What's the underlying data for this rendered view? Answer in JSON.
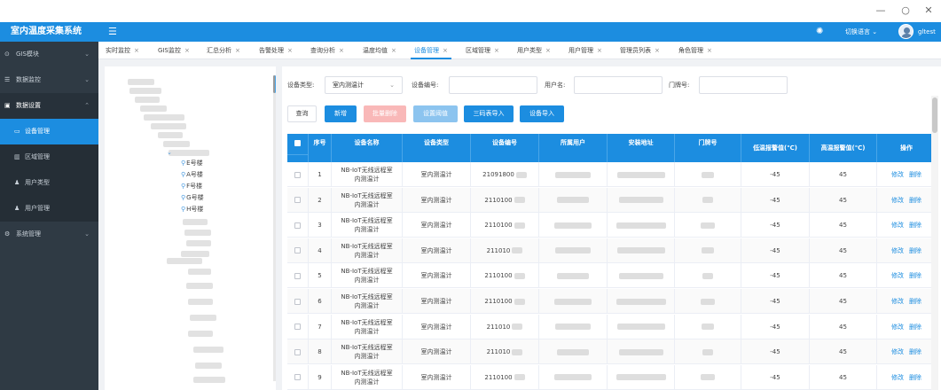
{
  "window": {
    "minimize": "—",
    "maximize": "○",
    "close": "✕"
  },
  "header": {
    "title": "室内温度采集系统",
    "menu_icon": "menu-icon",
    "lang_label": "切换语言 ⌄",
    "user": "gltest"
  },
  "sidebar": {
    "items": [
      {
        "label": "GIS模块",
        "icon": "⊙",
        "chev": "⌄"
      },
      {
        "label": "数据监控",
        "icon": "☰",
        "chev": "⌄"
      },
      {
        "label": "数据设置",
        "icon": "▣",
        "chev": "⌃"
      },
      {
        "label": "设备管理",
        "icon": "▭"
      },
      {
        "label": "区域管理",
        "icon": "▥"
      },
      {
        "label": "用户类型",
        "icon": "♟"
      },
      {
        "label": "用户管理",
        "icon": "♟"
      },
      {
        "label": "系统管理",
        "icon": "⚙",
        "chev": "⌄"
      }
    ]
  },
  "tabs": [
    {
      "label": "实时监控"
    },
    {
      "label": "GIS监控"
    },
    {
      "label": "汇总分析"
    },
    {
      "label": "告警处理"
    },
    {
      "label": "查询分析"
    },
    {
      "label": "温度均值"
    },
    {
      "label": "设备管理"
    },
    {
      "label": "区域管理"
    },
    {
      "label": "用户类型"
    },
    {
      "label": "用户管理"
    },
    {
      "label": "管理员列表"
    },
    {
      "label": "角色管理"
    }
  ],
  "tab_close": "×",
  "tree": {
    "pin": "⚲",
    "expand": "⌄",
    "nodes": [
      "E号楼",
      "A号楼",
      "F号楼",
      "G号楼",
      "H号楼"
    ]
  },
  "filters": {
    "device_type_label": "设备类型:",
    "device_type_value": "室内测温计",
    "device_type_arrow": "⌄",
    "device_no_label": "设备编号:",
    "username_label": "用户名:",
    "door_label": "门牌号:"
  },
  "buttons": {
    "query": "查询",
    "add": "新增",
    "batch_delete": "批量删除",
    "threshold": "设置阈值",
    "import_code": "三码表导入",
    "import_device": "设备导入"
  },
  "table": {
    "headers": [
      "序号",
      "设备名称",
      "设备类型",
      "设备编号",
      "所属用户",
      "安装地址",
      "门牌号",
      "低温报警值(℃)",
      "高温报警值(℃)",
      "操作"
    ],
    "edit": "修改",
    "delete": "删除",
    "rows": [
      {
        "no": "1",
        "name": "NB-IoT无线远程室内测温计",
        "type": "室内测温计",
        "code": "21091800",
        "low": "-45",
        "high": "45"
      },
      {
        "no": "2",
        "name": "NB-IoT无线远程室内测温计",
        "type": "室内测温计",
        "code": "2110100",
        "low": "-45",
        "high": "45"
      },
      {
        "no": "3",
        "name": "NB-IoT无线远程室内测温计",
        "type": "室内测温计",
        "code": "2110100",
        "low": "-45",
        "high": "45"
      },
      {
        "no": "4",
        "name": "NB-IoT无线远程室内测温计",
        "type": "室内测温计",
        "code": "211010",
        "low": "-45",
        "high": "45"
      },
      {
        "no": "5",
        "name": "NB-IoT无线远程室内测温计",
        "type": "室内测温计",
        "code": "2110100",
        "low": "-45",
        "high": "45"
      },
      {
        "no": "6",
        "name": "NB-IoT无线远程室内测温计",
        "type": "室内测温计",
        "code": "2110100",
        "low": "-45",
        "high": "45"
      },
      {
        "no": "7",
        "name": "NB-IoT无线远程室内测温计",
        "type": "室内测温计",
        "code": "211010",
        "low": "-45",
        "high": "45"
      },
      {
        "no": "8",
        "name": "NB-IoT无线远程室内测温计",
        "type": "室内测温计",
        "code": "211010",
        "low": "-45",
        "high": "45"
      },
      {
        "no": "9",
        "name": "NB-IoT无线远程室内测温计",
        "type": "室内测温计",
        "code": "2110100",
        "low": "-45",
        "high": "45"
      }
    ]
  },
  "colors": {
    "primary": "#1c8de0",
    "sidebar": "#2f3a44",
    "danger_disabled": "#f9b8b8"
  }
}
